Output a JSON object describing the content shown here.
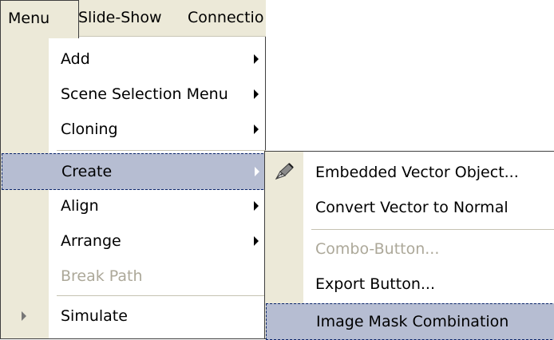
{
  "menubar": {
    "items": [
      {
        "label": "Menu"
      },
      {
        "label": "Slide-Show"
      },
      {
        "label": "Connectio"
      }
    ]
  },
  "menu": {
    "items": [
      {
        "label": "Add",
        "submenu": true
      },
      {
        "label": "Scene Selection Menu",
        "submenu": true
      },
      {
        "label": "Cloning",
        "submenu": true
      },
      {
        "label": "Create",
        "submenu": true,
        "highlighted": true
      },
      {
        "label": "Align",
        "submenu": true
      },
      {
        "label": "Arrange",
        "submenu": true
      },
      {
        "label": "Break Path",
        "disabled": true
      },
      {
        "label": "Simulate",
        "gutter_icon": "play-arrow-icon"
      }
    ]
  },
  "submenu": {
    "items": [
      {
        "label": "Embedded Vector Object...",
        "icon": "vector-pen-icon"
      },
      {
        "label": "Convert Vector to Normal"
      },
      {
        "label": "Combo-Button...",
        "disabled": true
      },
      {
        "label": "Export Button..."
      },
      {
        "label": "Image Mask Combination",
        "highlighted": true
      }
    ]
  },
  "colors": {
    "menubar_bg": "#ece9d8",
    "highlight_bg": "#b6bdd2",
    "highlight_border": "#0a246a",
    "disabled_text": "#aca899"
  }
}
